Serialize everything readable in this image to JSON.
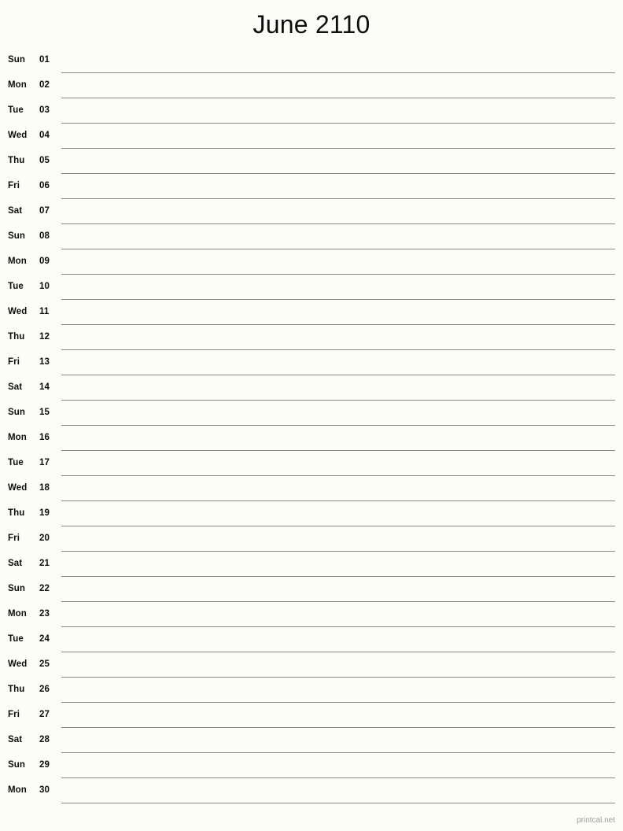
{
  "header": {
    "title": "June 2110"
  },
  "footer": {
    "credit": "printcal.net"
  },
  "colors": {
    "background": "#fdfdf8",
    "text": "#0d0d0d",
    "rule": "#8a8a8a",
    "footer_text": "#9a9a9a"
  },
  "calendar": {
    "month": "June",
    "year": "2110",
    "days": [
      {
        "dow": "Sun",
        "num": "01"
      },
      {
        "dow": "Mon",
        "num": "02"
      },
      {
        "dow": "Tue",
        "num": "03"
      },
      {
        "dow": "Wed",
        "num": "04"
      },
      {
        "dow": "Thu",
        "num": "05"
      },
      {
        "dow": "Fri",
        "num": "06"
      },
      {
        "dow": "Sat",
        "num": "07"
      },
      {
        "dow": "Sun",
        "num": "08"
      },
      {
        "dow": "Mon",
        "num": "09"
      },
      {
        "dow": "Tue",
        "num": "10"
      },
      {
        "dow": "Wed",
        "num": "11"
      },
      {
        "dow": "Thu",
        "num": "12"
      },
      {
        "dow": "Fri",
        "num": "13"
      },
      {
        "dow": "Sat",
        "num": "14"
      },
      {
        "dow": "Sun",
        "num": "15"
      },
      {
        "dow": "Mon",
        "num": "16"
      },
      {
        "dow": "Tue",
        "num": "17"
      },
      {
        "dow": "Wed",
        "num": "18"
      },
      {
        "dow": "Thu",
        "num": "19"
      },
      {
        "dow": "Fri",
        "num": "20"
      },
      {
        "dow": "Sat",
        "num": "21"
      },
      {
        "dow": "Sun",
        "num": "22"
      },
      {
        "dow": "Mon",
        "num": "23"
      },
      {
        "dow": "Tue",
        "num": "24"
      },
      {
        "dow": "Wed",
        "num": "25"
      },
      {
        "dow": "Thu",
        "num": "26"
      },
      {
        "dow": "Fri",
        "num": "27"
      },
      {
        "dow": "Sat",
        "num": "28"
      },
      {
        "dow": "Sun",
        "num": "29"
      },
      {
        "dow": "Mon",
        "num": "30"
      }
    ]
  }
}
